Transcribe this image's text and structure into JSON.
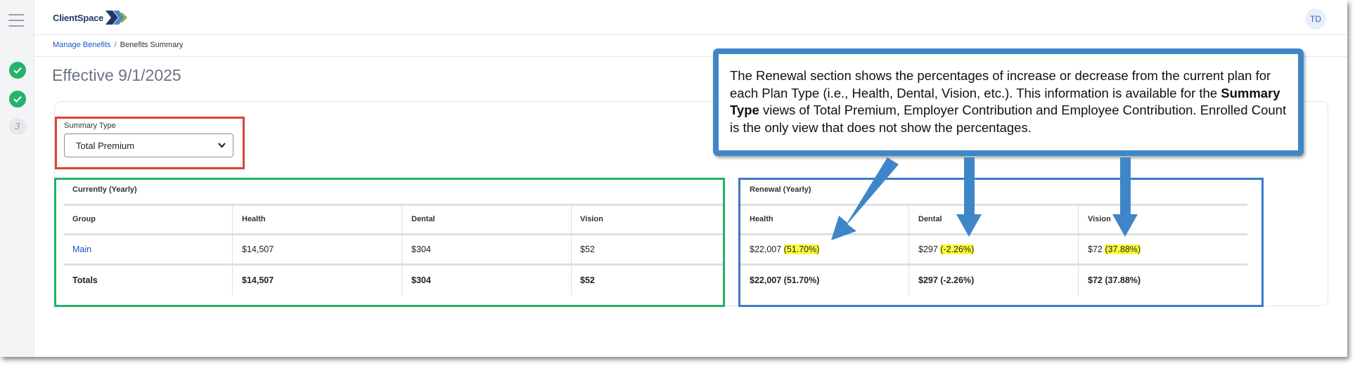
{
  "app": {
    "logo_text": "ClientSpace",
    "user_initials": "TD"
  },
  "steps": [
    {
      "state": "done"
    },
    {
      "state": "done"
    },
    {
      "state": "current",
      "label": "3"
    }
  ],
  "breadcrumb": {
    "parent": "Manage Benefits",
    "separator": "/",
    "current": "Benefits Summary"
  },
  "page": {
    "title": "Effective 9/1/2025"
  },
  "summary_type": {
    "label": "Summary Type",
    "selected": "Total Premium"
  },
  "current_table": {
    "title": "Currently (Yearly)",
    "columns": [
      "Group",
      "Health",
      "Dental",
      "Vision"
    ],
    "rows": [
      {
        "group": "Main",
        "health": "$14,507",
        "dental": "$304",
        "vision": "$52"
      }
    ],
    "totals": {
      "label": "Totals",
      "health": "$14,507",
      "dental": "$304",
      "vision": "$52"
    }
  },
  "renewal_table": {
    "title": "Renewal (Yearly)",
    "columns": [
      "Health",
      "Dental",
      "Vision"
    ],
    "row": {
      "health": {
        "value": "$22,007",
        "pct": "(51.70%)"
      },
      "dental": {
        "value": "$297",
        "pct": "(-2.26%)"
      },
      "vision": {
        "value": "$72",
        "pct": "(37.88%)"
      }
    },
    "totals": {
      "health": {
        "value": "$22,007",
        "pct": "(51.70%)"
      },
      "dental": {
        "value": "$297",
        "pct": "(-2.26%)"
      },
      "vision": {
        "value": "$72",
        "pct": "(37.88%)"
      }
    }
  },
  "callout": {
    "text_1": "The Renewal section shows the percentages of increase or decrease from the current plan for each Plan Type (i.e., Health, Dental, Vision, etc.). This information is available for the ",
    "text_bold": "Summary Type",
    "text_2": " views of Total Premium, Employer Contribution and Employee Contribution. Enrolled Count is the only view that does not show the percentages."
  },
  "colors": {
    "annotation_red": "#e0403a",
    "annotation_green": "#23b06b",
    "annotation_blue": "#3f86c8",
    "highlight": "#ffff3b",
    "link": "#1a56c4",
    "step_done": "#23b36b"
  },
  "icons": [
    "menu-icon",
    "check-icon",
    "check-icon",
    "chevron-down-icon",
    "callout-arrow-icon"
  ]
}
